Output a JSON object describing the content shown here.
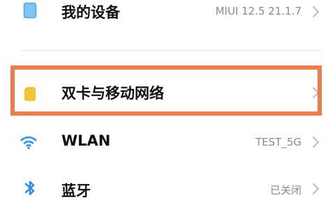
{
  "settings": {
    "items": [
      {
        "label": "我的设备",
        "value": "MIUI 12.5 21.1.7",
        "icon": "device-icon",
        "icon_color": "#4aa8e8"
      },
      {
        "label": "双卡与移动网络",
        "value": "",
        "icon": "sim-card-icon",
        "icon_color": "#f5c531"
      },
      {
        "label": "WLAN",
        "value": "TEST_5G",
        "icon": "wifi-icon",
        "icon_color": "#2f9bf0"
      },
      {
        "label": "蓝牙",
        "value": "已关闭",
        "icon": "bluetooth-icon",
        "icon_color": "#2f8fe8"
      }
    ]
  },
  "colors": {
    "highlight": "#f07a4a",
    "text_primary": "#111111",
    "text_secondary": "#8a8a8a",
    "chevron": "#b5b5b5"
  }
}
